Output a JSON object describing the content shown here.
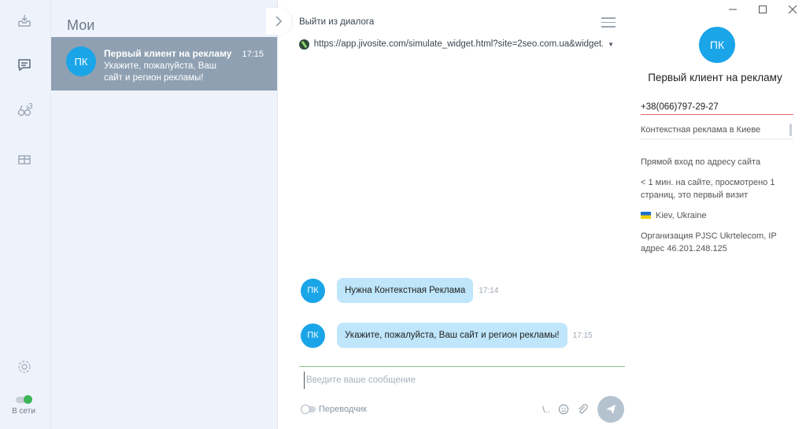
{
  "rail": {
    "badge_count": "3",
    "status_label": "В сети",
    "status_color": "#3cb556",
    "icons": [
      "inbox-icon",
      "chat-icon",
      "visitors-icon",
      "archive-icon",
      "settings-icon"
    ]
  },
  "list": {
    "title": "Мои",
    "items": [
      {
        "avatar": "ПК",
        "name": "Первый клиент на рекламу",
        "time": "17:15",
        "preview": "Укажите, пожалуйста, Ваш сайт и регион рекламы!"
      }
    ]
  },
  "dialog": {
    "exit_label": "Выйти из диалога",
    "url": "https://app.jivosite.com/simulate_widget.html?site=2seo.com.ua&widget...",
    "messages": [
      {
        "avatar": "ПК",
        "text": "Нужна Контекстная Реклама",
        "time": "17:14"
      },
      {
        "avatar": "ПК",
        "text": "Укажите, пожалуйста, Ваш сайт и регион рекламы!",
        "time": "17:15"
      }
    ],
    "input_placeholder": "Введите ваше сообщение",
    "translator_label": "Переводчик",
    "shortcut_label": "\\..",
    "accent_color": "#1aa5e8"
  },
  "visitor": {
    "avatar": "ПК",
    "name": "Первый клиент на рекламу",
    "phone": "+38(066)797-29-27",
    "note": "Контекстная реклама в Киеве",
    "source": "Прямой вход по адресу сайта",
    "visit_info": "< 1 мин. на сайте, просмотрено 1 страниц, это первый визит",
    "location": "Kiev, Ukraine",
    "organization": "Организация PJSC Ukrtelecom, IP адрес 46.201.248.125"
  }
}
